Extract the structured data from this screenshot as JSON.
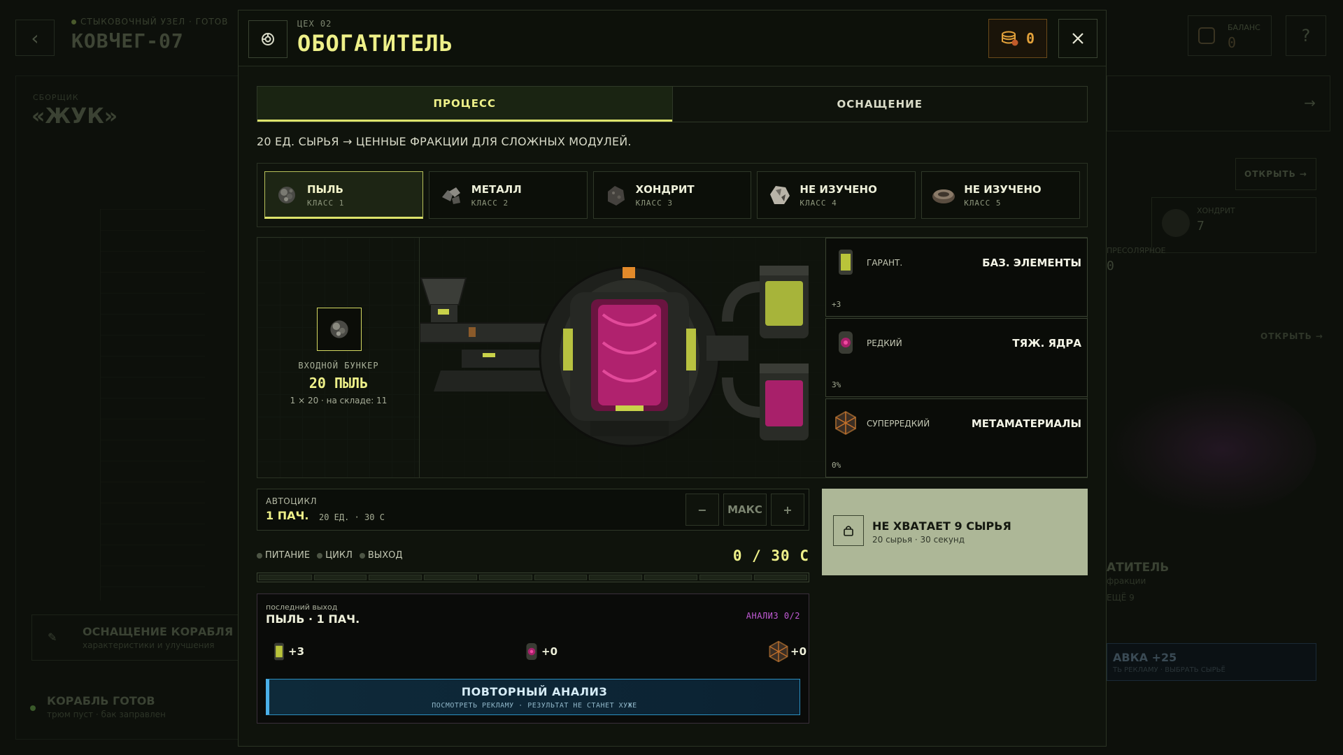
{
  "background": {
    "station": "СТЫКОВОЧНЫЙ УЗЕЛ · ГОТОВ",
    "ship_name": "КОВЧЕГ-07",
    "balance_label": "БАЛАНС",
    "balance_value": "0",
    "help": "?",
    "assembler_label": "СБОРЩИК",
    "assembler_name": "«ЖУК»",
    "equip_title": "ОСНАЩЕНИЕ КОРАБЛЯ",
    "equip_sub": "характеристики и улучшения",
    "ready_title": "КОРАБЛЬ ГОТОВ",
    "ready_sub": "трюм пуст · бак заправлен",
    "right_open_1": "ОТКРЫТЬ →",
    "right_card_title": "ХОНДРИТ",
    "right_card_value": "7",
    "right_pre_label": "ПРЕСОЛЯРНОЕ",
    "right_pre_value": "0",
    "right_open_2": "ОТКРЫТЬ →",
    "right_machine_name": "АТИТЕЛЬ",
    "right_machine_s1": "фракции",
    "right_machine_s2": "ЕЩЁ 9",
    "right_load_title": "АВКА +25",
    "right_load_sub": "ТЬ РЕКЛАМУ · ВЫБРАТЬ СЫРЬЁ"
  },
  "modal": {
    "subtitle": "ЦЕХ 02",
    "title": "ОБОГАТИТЕЛЬ",
    "coins": "0",
    "tabs": [
      {
        "label": "ПРОЦЕСС"
      },
      {
        "label": "ОСНАЩЕНИЕ"
      }
    ],
    "description": "20 ЕД. СЫРЬЯ → ЦЕННЫЕ ФРАКЦИИ ДЛЯ СЛОЖНЫХ МОДУЛЕЙ.",
    "resources": [
      {
        "name": "ПЫЛЬ",
        "class": "КЛАСС 1"
      },
      {
        "name": "МЕТАЛЛ",
        "class": "КЛАСС 2"
      },
      {
        "name": "ХОНДРИТ",
        "class": "КЛАСС 3"
      },
      {
        "name": "НЕ ИЗУЧЕНО",
        "class": "КЛАСС 4"
      },
      {
        "name": "НЕ ИЗУЧЕНО",
        "class": "КЛАСС 5"
      }
    ],
    "bunker": {
      "label": "ВХОДНОЙ БУНКЕР",
      "value": "20 ПЫЛЬ",
      "stock": "1 × 20 · на складе: 11"
    },
    "outputs": [
      {
        "tier": "ГАРАНТ.",
        "name": "БАЗ. ЭЛЕМЕНТЫ",
        "chance": "+3"
      },
      {
        "tier": "РЕДКИЙ",
        "name": "ТЯЖ. ЯДРА",
        "chance": "3%"
      },
      {
        "tier": "СУПЕРРЕДКИЙ",
        "name": "МЕТАМАТЕРИАЛЫ",
        "chance": "0%"
      }
    ],
    "autocycle": {
      "label": "АВТОЦИКЛ",
      "value": "1 ПАЧ.",
      "meta": "20 ЕД. · 30 С",
      "minus": "−",
      "max": "МАКС",
      "plus": "+"
    },
    "status": {
      "power": "ПИТАНИЕ",
      "cycle": "ЦИКЛ",
      "output": "ВЫХОД",
      "timer": "0 / 30 С",
      "progress": 0
    },
    "cta": {
      "title": "НЕ ХВАТАЕТ 9 СЫРЬЯ",
      "sub": "20 сырья · 30 секунд"
    },
    "last_output": {
      "label": "последний выход",
      "title": "ПЫЛЬ · 1 ПАЧ.",
      "analysis": "АНАЛИЗ 0/2",
      "items": [
        "+3",
        "+0",
        "+0"
      ],
      "reanalyze_title": "ПОВТОРНЫЙ АНАЛИЗ",
      "reanalyze_sub": "ПОСМОТРЕТЬ РЕКЛАМУ · РЕЗУЛЬТАТ НЕ СТАНЕТ ХУЖЕ"
    }
  },
  "colors": {
    "accent": "#eef089",
    "coin": "#e2a13a",
    "rare": "#c25bd6",
    "ad_blue": "#2b8fc0"
  }
}
